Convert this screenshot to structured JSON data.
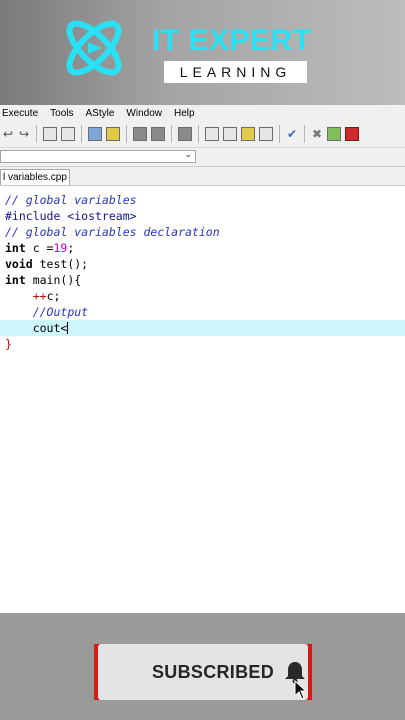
{
  "banner": {
    "title": "IT EXPERT",
    "subtitle": "LEARNING",
    "colors": {
      "title": "#29e0f5",
      "logo": "#29e0f5"
    }
  },
  "menu": [
    "Execute",
    "Tools",
    "AStyle",
    "Window",
    "Help"
  ],
  "tab": {
    "label": "l variables.cpp"
  },
  "code": [
    {
      "parts": [
        {
          "t": "// global variables",
          "c": "cm"
        }
      ]
    },
    {
      "parts": [
        {
          "t": "#include <iostream>",
          "c": "pp"
        }
      ]
    },
    {
      "parts": [
        {
          "t": "// global variables declaration",
          "c": "cm"
        }
      ]
    },
    {
      "parts": [
        {
          "t": "int",
          "c": "kw"
        },
        {
          "t": " c =",
          "c": ""
        },
        {
          "t": "19",
          "c": "num"
        },
        {
          "t": ";",
          "c": ""
        }
      ]
    },
    {
      "parts": [
        {
          "t": "void",
          "c": "kw"
        },
        {
          "t": " test();",
          "c": ""
        }
      ]
    },
    {
      "parts": [
        {
          "t": "int",
          "c": "kw"
        },
        {
          "t": " main(){",
          "c": ""
        }
      ]
    },
    {
      "parts": [
        {
          "t": "    ",
          "c": ""
        },
        {
          "t": "++",
          "c": "red"
        },
        {
          "t": "c;",
          "c": ""
        }
      ]
    },
    {
      "parts": [
        {
          "t": "    ",
          "c": ""
        },
        {
          "t": "//Output",
          "c": "cm"
        }
      ]
    },
    {
      "highlight": true,
      "caret": true,
      "parts": [
        {
          "t": "    cout<",
          "c": ""
        }
      ]
    },
    {
      "parts": [
        {
          "t": "}",
          "c": "red"
        }
      ]
    }
  ],
  "subscribe": {
    "label": "SUBSCRIBED",
    "icon": "bell-icon",
    "colors": {
      "frame": "#d61a1a",
      "button": "#e4e4e4"
    }
  }
}
